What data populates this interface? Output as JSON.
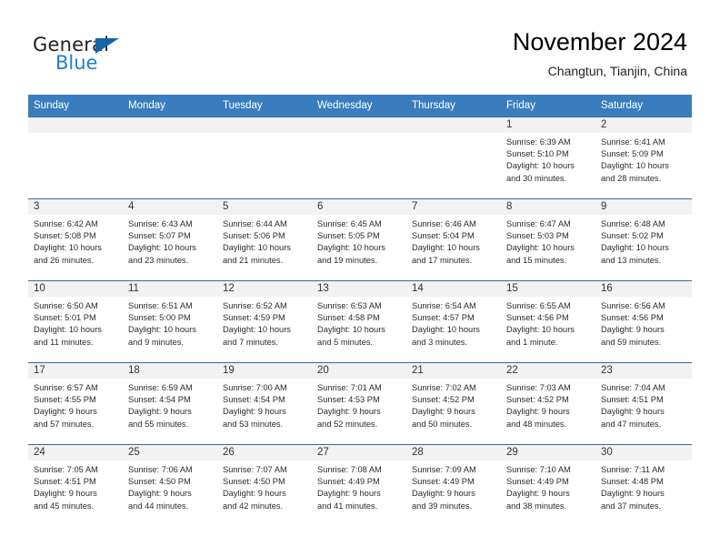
{
  "brand": {
    "name_part1": "General",
    "name_part2": "Blue",
    "triangle_color": "#1565a8",
    "blue_color": "#1c7fd4"
  },
  "header": {
    "title": "November 2024",
    "location": "Changtun, Tianjin, China"
  },
  "theme": {
    "header_bg": "#3a7dbf",
    "row_border": "#2e6da4",
    "daynum_band": "#f2f2f2",
    "text": "#2b2b2b"
  },
  "weekdays": [
    "Sunday",
    "Monday",
    "Tuesday",
    "Wednesday",
    "Thursday",
    "Friday",
    "Saturday"
  ],
  "weeks": [
    [
      {
        "day": "",
        "sunrise": "",
        "sunset": "",
        "daylight1": "",
        "daylight2": ""
      },
      {
        "day": "",
        "sunrise": "",
        "sunset": "",
        "daylight1": "",
        "daylight2": ""
      },
      {
        "day": "",
        "sunrise": "",
        "sunset": "",
        "daylight1": "",
        "daylight2": ""
      },
      {
        "day": "",
        "sunrise": "",
        "sunset": "",
        "daylight1": "",
        "daylight2": ""
      },
      {
        "day": "",
        "sunrise": "",
        "sunset": "",
        "daylight1": "",
        "daylight2": ""
      },
      {
        "day": "1",
        "sunrise": "Sunrise: 6:39 AM",
        "sunset": "Sunset: 5:10 PM",
        "daylight1": "Daylight: 10 hours",
        "daylight2": "and 30 minutes."
      },
      {
        "day": "2",
        "sunrise": "Sunrise: 6:41 AM",
        "sunset": "Sunset: 5:09 PM",
        "daylight1": "Daylight: 10 hours",
        "daylight2": "and 28 minutes."
      }
    ],
    [
      {
        "day": "3",
        "sunrise": "Sunrise: 6:42 AM",
        "sunset": "Sunset: 5:08 PM",
        "daylight1": "Daylight: 10 hours",
        "daylight2": "and 26 minutes."
      },
      {
        "day": "4",
        "sunrise": "Sunrise: 6:43 AM",
        "sunset": "Sunset: 5:07 PM",
        "daylight1": "Daylight: 10 hours",
        "daylight2": "and 23 minutes."
      },
      {
        "day": "5",
        "sunrise": "Sunrise: 6:44 AM",
        "sunset": "Sunset: 5:06 PM",
        "daylight1": "Daylight: 10 hours",
        "daylight2": "and 21 minutes."
      },
      {
        "day": "6",
        "sunrise": "Sunrise: 6:45 AM",
        "sunset": "Sunset: 5:05 PM",
        "daylight1": "Daylight: 10 hours",
        "daylight2": "and 19 minutes."
      },
      {
        "day": "7",
        "sunrise": "Sunrise: 6:46 AM",
        "sunset": "Sunset: 5:04 PM",
        "daylight1": "Daylight: 10 hours",
        "daylight2": "and 17 minutes."
      },
      {
        "day": "8",
        "sunrise": "Sunrise: 6:47 AM",
        "sunset": "Sunset: 5:03 PM",
        "daylight1": "Daylight: 10 hours",
        "daylight2": "and 15 minutes."
      },
      {
        "day": "9",
        "sunrise": "Sunrise: 6:48 AM",
        "sunset": "Sunset: 5:02 PM",
        "daylight1": "Daylight: 10 hours",
        "daylight2": "and 13 minutes."
      }
    ],
    [
      {
        "day": "10",
        "sunrise": "Sunrise: 6:50 AM",
        "sunset": "Sunset: 5:01 PM",
        "daylight1": "Daylight: 10 hours",
        "daylight2": "and 11 minutes."
      },
      {
        "day": "11",
        "sunrise": "Sunrise: 6:51 AM",
        "sunset": "Sunset: 5:00 PM",
        "daylight1": "Daylight: 10 hours",
        "daylight2": "and 9 minutes."
      },
      {
        "day": "12",
        "sunrise": "Sunrise: 6:52 AM",
        "sunset": "Sunset: 4:59 PM",
        "daylight1": "Daylight: 10 hours",
        "daylight2": "and 7 minutes."
      },
      {
        "day": "13",
        "sunrise": "Sunrise: 6:53 AM",
        "sunset": "Sunset: 4:58 PM",
        "daylight1": "Daylight: 10 hours",
        "daylight2": "and 5 minutes."
      },
      {
        "day": "14",
        "sunrise": "Sunrise: 6:54 AM",
        "sunset": "Sunset: 4:57 PM",
        "daylight1": "Daylight: 10 hours",
        "daylight2": "and 3 minutes."
      },
      {
        "day": "15",
        "sunrise": "Sunrise: 6:55 AM",
        "sunset": "Sunset: 4:56 PM",
        "daylight1": "Daylight: 10 hours",
        "daylight2": "and 1 minute."
      },
      {
        "day": "16",
        "sunrise": "Sunrise: 6:56 AM",
        "sunset": "Sunset: 4:56 PM",
        "daylight1": "Daylight: 9 hours",
        "daylight2": "and 59 minutes."
      }
    ],
    [
      {
        "day": "17",
        "sunrise": "Sunrise: 6:57 AM",
        "sunset": "Sunset: 4:55 PM",
        "daylight1": "Daylight: 9 hours",
        "daylight2": "and 57 minutes."
      },
      {
        "day": "18",
        "sunrise": "Sunrise: 6:59 AM",
        "sunset": "Sunset: 4:54 PM",
        "daylight1": "Daylight: 9 hours",
        "daylight2": "and 55 minutes."
      },
      {
        "day": "19",
        "sunrise": "Sunrise: 7:00 AM",
        "sunset": "Sunset: 4:54 PM",
        "daylight1": "Daylight: 9 hours",
        "daylight2": "and 53 minutes."
      },
      {
        "day": "20",
        "sunrise": "Sunrise: 7:01 AM",
        "sunset": "Sunset: 4:53 PM",
        "daylight1": "Daylight: 9 hours",
        "daylight2": "and 52 minutes."
      },
      {
        "day": "21",
        "sunrise": "Sunrise: 7:02 AM",
        "sunset": "Sunset: 4:52 PM",
        "daylight1": "Daylight: 9 hours",
        "daylight2": "and 50 minutes."
      },
      {
        "day": "22",
        "sunrise": "Sunrise: 7:03 AM",
        "sunset": "Sunset: 4:52 PM",
        "daylight1": "Daylight: 9 hours",
        "daylight2": "and 48 minutes."
      },
      {
        "day": "23",
        "sunrise": "Sunrise: 7:04 AM",
        "sunset": "Sunset: 4:51 PM",
        "daylight1": "Daylight: 9 hours",
        "daylight2": "and 47 minutes."
      }
    ],
    [
      {
        "day": "24",
        "sunrise": "Sunrise: 7:05 AM",
        "sunset": "Sunset: 4:51 PM",
        "daylight1": "Daylight: 9 hours",
        "daylight2": "and 45 minutes."
      },
      {
        "day": "25",
        "sunrise": "Sunrise: 7:06 AM",
        "sunset": "Sunset: 4:50 PM",
        "daylight1": "Daylight: 9 hours",
        "daylight2": "and 44 minutes."
      },
      {
        "day": "26",
        "sunrise": "Sunrise: 7:07 AM",
        "sunset": "Sunset: 4:50 PM",
        "daylight1": "Daylight: 9 hours",
        "daylight2": "and 42 minutes."
      },
      {
        "day": "27",
        "sunrise": "Sunrise: 7:08 AM",
        "sunset": "Sunset: 4:49 PM",
        "daylight1": "Daylight: 9 hours",
        "daylight2": "and 41 minutes."
      },
      {
        "day": "28",
        "sunrise": "Sunrise: 7:09 AM",
        "sunset": "Sunset: 4:49 PM",
        "daylight1": "Daylight: 9 hours",
        "daylight2": "and 39 minutes."
      },
      {
        "day": "29",
        "sunrise": "Sunrise: 7:10 AM",
        "sunset": "Sunset: 4:49 PM",
        "daylight1": "Daylight: 9 hours",
        "daylight2": "and 38 minutes."
      },
      {
        "day": "30",
        "sunrise": "Sunrise: 7:11 AM",
        "sunset": "Sunset: 4:48 PM",
        "daylight1": "Daylight: 9 hours",
        "daylight2": "and 37 minutes."
      }
    ]
  ]
}
